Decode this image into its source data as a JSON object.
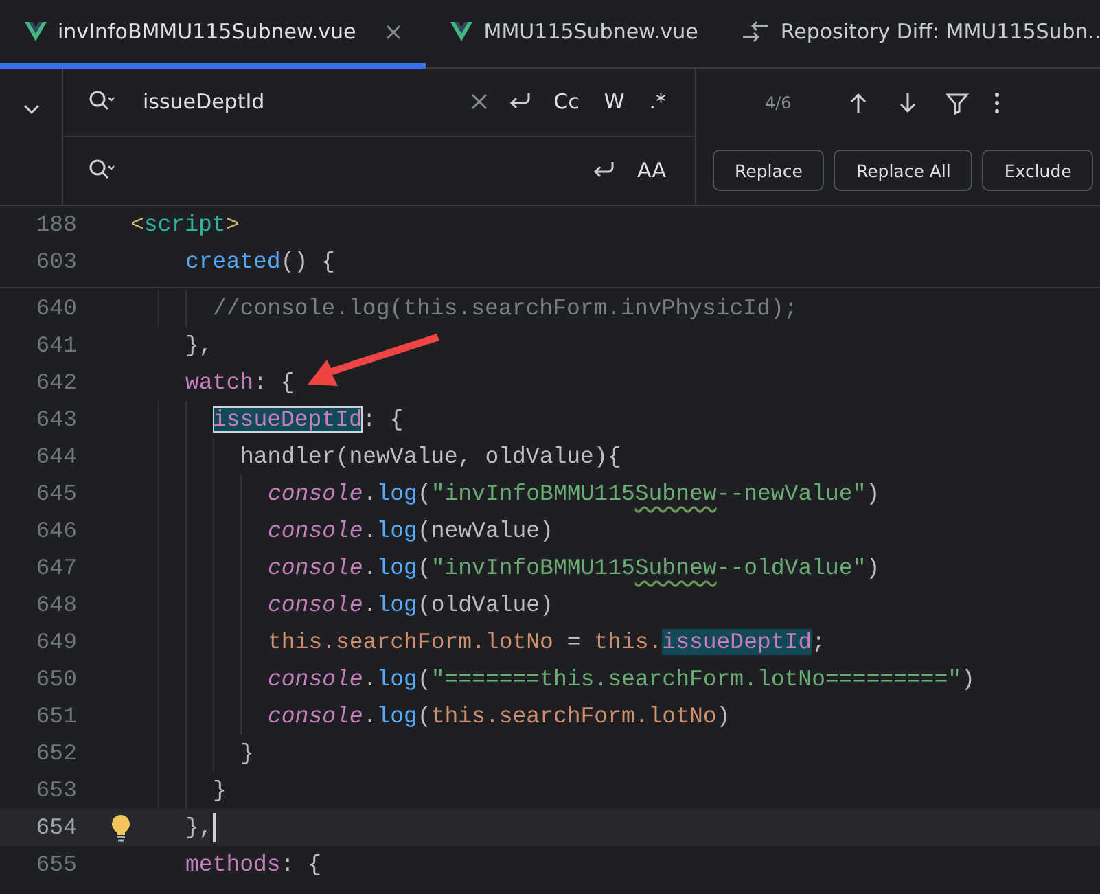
{
  "tabs": [
    {
      "label": "invInfoBMMU115Subnew.vue",
      "kind": "vue",
      "selected": true
    },
    {
      "label": "MMU115Subnew.vue",
      "kind": "vue",
      "selected": false
    },
    {
      "label": "Repository Diff: MMU115Subn..",
      "kind": "diff",
      "selected": false
    }
  ],
  "find": {
    "value": "issueDeptId",
    "options": [
      "Cc",
      "W",
      ".*"
    ],
    "count": "4/6"
  },
  "replace": {
    "preserve_case": "AA",
    "buttons": [
      "Replace",
      "Replace All",
      "Exclude"
    ]
  },
  "code": [
    {
      "number": "188",
      "current": false,
      "tokens": [
        {
          "kind": "tagp",
          "text": "<"
        },
        {
          "kind": "tag",
          "text": "script"
        },
        {
          "kind": "tagp",
          "text": ">"
        }
      ],
      "children": [
        {
          "number": "603",
          "current": false,
          "tokens": [
            {
              "kind": "fn",
              "text": "created"
            },
            {
              "kind": "p",
              "text": "() {"
            }
          ],
          "children": [
            {
              "number": "640",
              "current": false,
              "tokens": [
                {
                  "kind": "com",
                  "text": "//console.log(this.searchForm.invPhysicId);"
                }
              ]
            }
          ]
        },
        {
          "number": "641",
          "current": false,
          "tokens": [
            {
              "kind": "p",
              "text": "},"
            }
          ]
        },
        {
          "number": "642",
          "current": false,
          "tokens": [
            {
              "kind": "kw",
              "text": "watch"
            },
            {
              "kind": "p",
              "text": ": {"
            }
          ],
          "children": [
            {
              "number": "643",
              "current": false,
              "tokens": [
                {
                  "kind": "match",
                  "text": "issueDeptId",
                  "selected": true
                },
                {
                  "kind": "p",
                  "text": ": {"
                }
              ],
              "children": [
                {
                  "number": "644",
                  "current": false,
                  "tokens": [
                    {
                      "kind": "p",
                      "text": "handler(newValue, oldValue){"
                    }
                  ],
                  "children": [
                    {
                      "number": "645",
                      "current": false,
                      "tokens": [
                        {
                          "kind": "con",
                          "text": "console"
                        },
                        {
                          "kind": "p",
                          "text": "."
                        },
                        {
                          "kind": "fn",
                          "text": "log"
                        },
                        {
                          "kind": "p",
                          "text": "("
                        },
                        {
                          "kind": "str",
                          "text": "\"invInfoBMMU115"
                        },
                        {
                          "kind": "typo",
                          "text": "Subnew"
                        },
                        {
                          "kind": "str",
                          "text": "--newValue\""
                        },
                        {
                          "kind": "p",
                          "text": ")"
                        }
                      ]
                    },
                    {
                      "number": "646",
                      "current": false,
                      "tokens": [
                        {
                          "kind": "con",
                          "text": "console"
                        },
                        {
                          "kind": "p",
                          "text": "."
                        },
                        {
                          "kind": "fn",
                          "text": "log"
                        },
                        {
                          "kind": "p",
                          "text": "(newValue)"
                        }
                      ]
                    },
                    {
                      "number": "647",
                      "current": false,
                      "tokens": [
                        {
                          "kind": "con",
                          "text": "console"
                        },
                        {
                          "kind": "p",
                          "text": "."
                        },
                        {
                          "kind": "fn",
                          "text": "log"
                        },
                        {
                          "kind": "p",
                          "text": "("
                        },
                        {
                          "kind": "str",
                          "text": "\"invInfoBMMU115"
                        },
                        {
                          "kind": "typo",
                          "text": "Subnew"
                        },
                        {
                          "kind": "str",
                          "text": "--oldValue\""
                        },
                        {
                          "kind": "p",
                          "text": ")"
                        }
                      ]
                    },
                    {
                      "number": "648",
                      "current": false,
                      "tokens": [
                        {
                          "kind": "con",
                          "text": "console"
                        },
                        {
                          "kind": "p",
                          "text": "."
                        },
                        {
                          "kind": "fn",
                          "text": "log"
                        },
                        {
                          "kind": "p",
                          "text": "(oldValue)"
                        }
                      ]
                    },
                    {
                      "number": "649",
                      "current": false,
                      "tokens": [
                        {
                          "kind": "this",
                          "text": "this.searchForm.lotNo"
                        },
                        {
                          "kind": "p",
                          "text": " = "
                        },
                        {
                          "kind": "this",
                          "text": "this."
                        },
                        {
                          "kind": "match",
                          "text": "issueDeptId",
                          "selected": false
                        },
                        {
                          "kind": "p",
                          "text": ";"
                        }
                      ]
                    },
                    {
                      "number": "650",
                      "current": false,
                      "tokens": [
                        {
                          "kind": "con",
                          "text": "console"
                        },
                        {
                          "kind": "p",
                          "text": "."
                        },
                        {
                          "kind": "fn",
                          "text": "log"
                        },
                        {
                          "kind": "p",
                          "text": "("
                        },
                        {
                          "kind": "str",
                          "text": "\"=======this.searchForm.lotNo=========\""
                        },
                        {
                          "kind": "p",
                          "text": ")"
                        }
                      ]
                    },
                    {
                      "number": "651",
                      "current": false,
                      "tokens": [
                        {
                          "kind": "con",
                          "text": "console"
                        },
                        {
                          "kind": "p",
                          "text": "."
                        },
                        {
                          "kind": "fn",
                          "text": "log"
                        },
                        {
                          "kind": "p",
                          "text": "("
                        },
                        {
                          "kind": "this",
                          "text": "this.searchForm.lotNo"
                        },
                        {
                          "kind": "p",
                          "text": ")"
                        }
                      ]
                    }
                  ]
                },
                {
                  "number": "652",
                  "current": false,
                  "tokens": [
                    {
                      "kind": "p",
                      "text": "}"
                    }
                  ]
                }
              ]
            },
            {
              "number": "653",
              "current": false,
              "tokens": [
                {
                  "kind": "p",
                  "text": "}"
                }
              ]
            }
          ]
        },
        {
          "number": "654",
          "current": true,
          "bulb": true,
          "tokens": [
            {
              "kind": "p",
              "text": "},"
            }
          ]
        },
        {
          "number": "655",
          "current": false,
          "tokens": [
            {
              "kind": "kw",
              "text": "methods"
            },
            {
              "kind": "p",
              "text": ": {"
            }
          ]
        }
      ]
    }
  ]
}
